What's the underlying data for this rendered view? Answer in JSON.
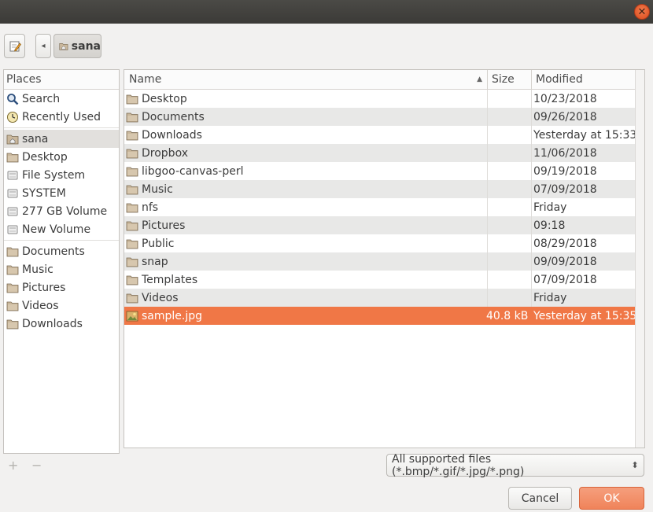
{
  "window": {
    "close_glyph": "✕"
  },
  "toolbar": {
    "edit_icon": "pencil-icon",
    "back_glyph": "◂",
    "crumb_label": "sana"
  },
  "places": {
    "header": "Places",
    "items": [
      {
        "label": "Search",
        "icon": "search-icon",
        "group": 1
      },
      {
        "label": "Recently Used",
        "icon": "recent-icon",
        "group": 1
      },
      {
        "label": "sana",
        "icon": "home-folder-icon",
        "group": 2,
        "selected": true
      },
      {
        "label": "Desktop",
        "icon": "folder-icon",
        "group": 2
      },
      {
        "label": "File System",
        "icon": "drive-icon",
        "group": 2
      },
      {
        "label": "SYSTEM",
        "icon": "drive-icon",
        "group": 2
      },
      {
        "label": "277 GB Volume",
        "icon": "drive-icon",
        "group": 2
      },
      {
        "label": "New Volume",
        "icon": "drive-icon",
        "group": 2
      },
      {
        "label": "Documents",
        "icon": "folder-icon",
        "group": 3
      },
      {
        "label": "Music",
        "icon": "folder-icon",
        "group": 3
      },
      {
        "label": "Pictures",
        "icon": "folder-icon",
        "group": 3
      },
      {
        "label": "Videos",
        "icon": "folder-icon",
        "group": 3
      },
      {
        "label": "Downloads",
        "icon": "folder-icon",
        "group": 3
      }
    ],
    "add_glyph": "+",
    "remove_glyph": "−"
  },
  "files": {
    "columns": {
      "name": "Name",
      "size": "Size",
      "modified": "Modified"
    },
    "sort_glyph": "▲",
    "rows": [
      {
        "name": "Desktop",
        "size": "",
        "modified": "10/23/2018",
        "icon": "folder-icon"
      },
      {
        "name": "Documents",
        "size": "",
        "modified": "09/26/2018",
        "icon": "folder-icon"
      },
      {
        "name": "Downloads",
        "size": "",
        "modified": "Yesterday at 15:33",
        "icon": "folder-icon"
      },
      {
        "name": "Dropbox",
        "size": "",
        "modified": "11/06/2018",
        "icon": "folder-icon"
      },
      {
        "name": "libgoo-canvas-perl",
        "size": "",
        "modified": "09/19/2018",
        "icon": "folder-icon"
      },
      {
        "name": "Music",
        "size": "",
        "modified": "07/09/2018",
        "icon": "folder-icon"
      },
      {
        "name": "nfs",
        "size": "",
        "modified": "Friday",
        "icon": "folder-icon"
      },
      {
        "name": "Pictures",
        "size": "",
        "modified": "09:18",
        "icon": "folder-icon"
      },
      {
        "name": "Public",
        "size": "",
        "modified": "08/29/2018",
        "icon": "folder-icon"
      },
      {
        "name": "snap",
        "size": "",
        "modified": "09/09/2018",
        "icon": "folder-icon"
      },
      {
        "name": "Templates",
        "size": "",
        "modified": "07/09/2018",
        "icon": "folder-icon"
      },
      {
        "name": "Videos",
        "size": "",
        "modified": "Friday",
        "icon": "folder-icon"
      },
      {
        "name": "sample.jpg",
        "size": "40.8 kB",
        "modified": "Yesterday at 15:35",
        "icon": "image-icon",
        "selected": true
      }
    ]
  },
  "filter": {
    "selected": "All supported files (*.bmp/*.gif/*.jpg/*.png)",
    "arrows_glyph": "⬍"
  },
  "buttons": {
    "cancel": "Cancel",
    "ok": "OK"
  },
  "colors": {
    "accent": "#f07746",
    "titlebar": "#3f3e3a"
  }
}
